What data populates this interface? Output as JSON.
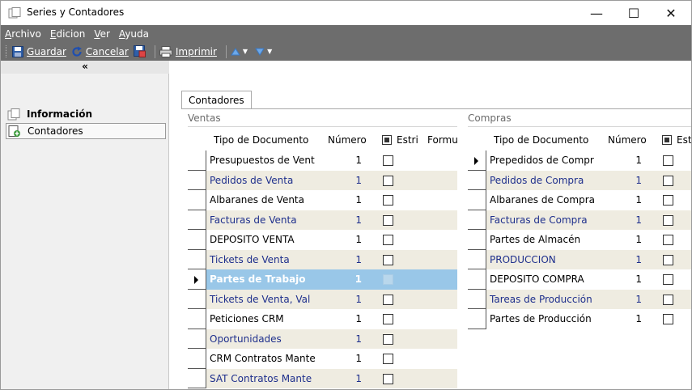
{
  "window": {
    "title": "Series y Contadores",
    "minimize": "—",
    "maximize": "☐",
    "close": "✕"
  },
  "menu": [
    "Archivo",
    "Edicion",
    "Ver",
    "Ayuda"
  ],
  "toolbar": {
    "save_label": "Guardar",
    "cancel_label": "Cancelar",
    "print_label": "Imprimir"
  },
  "sidebar": {
    "collapse_label": "«",
    "items": [
      {
        "label": "Información"
      },
      {
        "label": "Contadores"
      }
    ]
  },
  "tabs": [
    {
      "label": "Contadores"
    }
  ],
  "ventas": {
    "title": "Ventas",
    "columns": [
      "Tipo de Documento",
      "Número",
      "Estri",
      "Formula"
    ],
    "rows": [
      {
        "doc": "Presupuestos de Vent",
        "num": "1"
      },
      {
        "doc": "Pedidos de Venta",
        "num": "1"
      },
      {
        "doc": "Albaranes de Venta",
        "num": "1"
      },
      {
        "doc": "Facturas de Venta",
        "num": "1"
      },
      {
        "doc": "DEPOSITO VENTA",
        "num": "1"
      },
      {
        "doc": "Tickets de Venta",
        "num": "1"
      },
      {
        "doc": "Partes de Trabajo",
        "num": "1"
      },
      {
        "doc": "Tickets de Venta, Val",
        "num": "1"
      },
      {
        "doc": "Peticiones CRM",
        "num": "1"
      },
      {
        "doc": "Oportunidades",
        "num": "1"
      },
      {
        "doc": "CRM Contratos Mante",
        "num": "1"
      },
      {
        "doc": "SAT Contratos Mante",
        "num": "1"
      }
    ]
  },
  "compras": {
    "title": "Compras",
    "columns": [
      "Tipo de Documento",
      "Número",
      "Estr"
    ],
    "rows": [
      {
        "doc": "Prepedidos de Compr",
        "num": "1"
      },
      {
        "doc": "Pedidos de Compra",
        "num": "1"
      },
      {
        "doc": "Albaranes de Compra",
        "num": "1"
      },
      {
        "doc": "Facturas de Compra",
        "num": "1"
      },
      {
        "doc": "Partes de Almacén",
        "num": "1"
      },
      {
        "doc": "PRODUCCION",
        "num": "1"
      },
      {
        "doc": "DEPOSITO COMPRA",
        "num": "1"
      },
      {
        "doc": "Tareas de Producción",
        "num": "1"
      },
      {
        "doc": "Partes de Producción",
        "num": "1"
      }
    ]
  }
}
